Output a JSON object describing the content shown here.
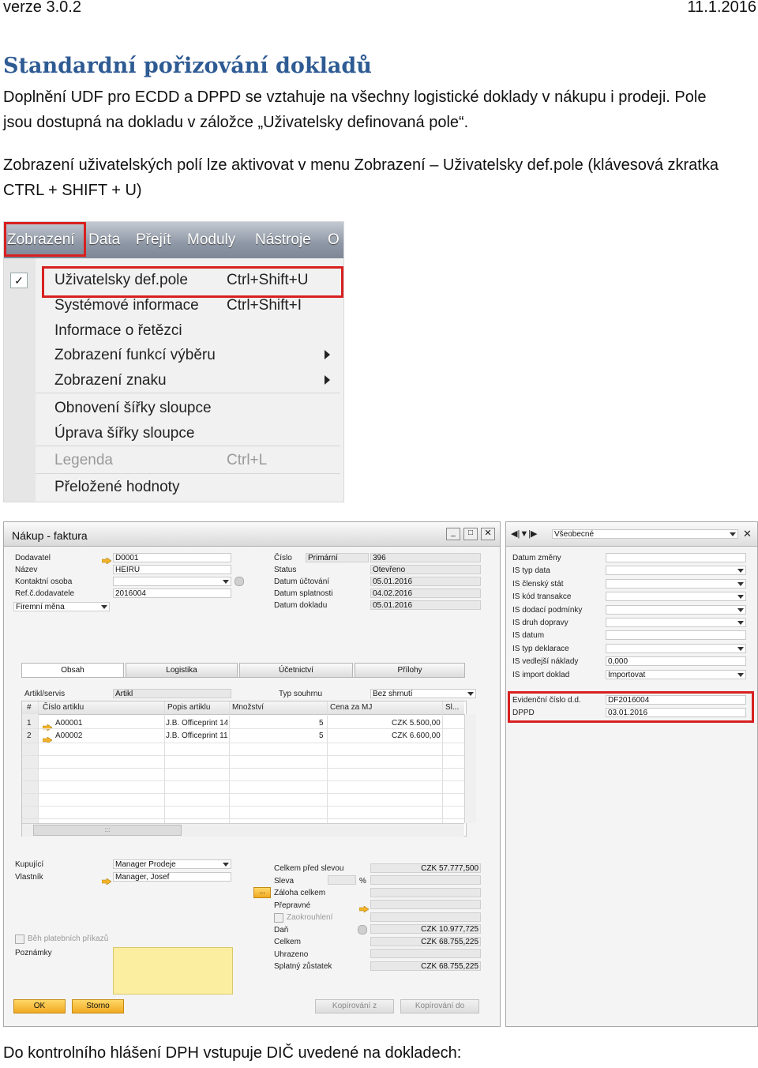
{
  "header": {
    "version": "verze 3.0.2",
    "date": "11.1.2016"
  },
  "heading": "Standardní pořizování dokladů",
  "paragraph1_line1": "Doplnění UDF pro ECDD a DPPD se vztahuje na všechny logistické doklady v nákupu i prodeji. Pole",
  "paragraph1_line2": "jsou dostupná na dokladu v záložce „Uživatelsky definovaná pole“.",
  "paragraph2_line1": "Zobrazení uživatelských polí lze aktivovat v menu Zobrazení – Uživatelsky def.pole (klávesová zkratka",
  "paragraph2_line2": "CTRL + SHIFT + U)",
  "menu": {
    "bar": [
      "Zobrazení",
      "Data",
      "Přejít",
      "Moduly",
      "Nástroje",
      "O"
    ],
    "items": [
      {
        "label": "Uživatelsky def.pole",
        "shortcut": "Ctrl+Shift+U"
      },
      {
        "label": "Systémové informace",
        "shortcut": "Ctrl+Shift+I"
      },
      {
        "label": "Informace o řetězci",
        "shortcut": ""
      },
      {
        "label": "Zobrazení funkcí výběru",
        "shortcut": ""
      },
      {
        "label": "Zobrazení znaku",
        "shortcut": ""
      },
      {
        "label": "Obnovení šířky sloupce",
        "shortcut": ""
      },
      {
        "label": "Úprava šířky sloupce",
        "shortcut": ""
      },
      {
        "label": "Legenda",
        "shortcut": "Ctrl+L"
      },
      {
        "label": "Přeložené hodnoty",
        "shortcut": ""
      }
    ]
  },
  "form": {
    "title": "Nákup - faktura",
    "left_labels": [
      "Dodavatel",
      "Název",
      "Kontaktní osoba",
      "Ref.č.dodavatele",
      "Firemní měna"
    ],
    "left_values": [
      "D0001",
      "HEIRU",
      "",
      "2016004"
    ],
    "right_labels": [
      "Číslo",
      "Status",
      "Datum účtování",
      "Datum splatnosti",
      "Datum dokladu"
    ],
    "cislo_type": "Primární",
    "right_values": [
      "396",
      "Otevřeno",
      "05.01.2016",
      "04.02.2016",
      "05.01.2016"
    ],
    "tabs": [
      "Obsah",
      "Logistika",
      "Účetnictví",
      "Přílohy"
    ],
    "item_type_label": "Artikl/servis",
    "item_type_value": "Artikl",
    "summary_type_label": "Typ souhrnu",
    "summary_type_value": "Bez shrnutí",
    "grid_headers": [
      "#",
      "Číslo artiklu",
      "Popis artiklu",
      "Množství",
      "Cena za MJ",
      "Sl..."
    ],
    "rows": [
      {
        "n": "1",
        "item": "A00001",
        "desc": "J.B. Officeprint 14",
        "qty": "5",
        "price": "CZK 5.500,00"
      },
      {
        "n": "2",
        "item": "A00002",
        "desc": "J.B. Officeprint 11",
        "qty": "5",
        "price": "CZK 6.600,00"
      }
    ],
    "grid_footer": ":::",
    "buyer_label": "Kupující",
    "buyer_value": "Manager Prodeje",
    "owner_label": "Vlastník",
    "owner_value": "Manager, Josef",
    "payment_orders": "Běh platebních příkazů",
    "notes_label": "Poznámky",
    "ellipsis": "...",
    "totals_labels": [
      "Celkem před slevou",
      "Sleva",
      "Záloha celkem",
      "Přepravné",
      "Zaokrouhlení",
      "Daň",
      "Celkem",
      "Uhrazeno",
      "Splatný zůstatek"
    ],
    "totals_values": [
      "CZK 57.777,500",
      "",
      "",
      "",
      "",
      "CZK 10.977,725",
      "CZK 68.755,225",
      "",
      "CZK 68.755,225"
    ],
    "percent": "%",
    "buttons": {
      "ok": "OK",
      "cancel": "Storno",
      "copy_from": "Kopírování z",
      "copy_to": "Kopírování do"
    }
  },
  "udf": {
    "dropdown": "Všeobecné",
    "labels": [
      "Datum změny",
      "IS typ data",
      "IS členský stát",
      "IS kód transakce",
      "IS dodací podmínky",
      "IS druh dopravy",
      "IS datum",
      "IS typ deklarace",
      "IS vedlejší náklady",
      "IS import doklad"
    ],
    "values": [
      "",
      "",
      "",
      "",
      "",
      "",
      "",
      "",
      "0,000",
      "Importovat"
    ],
    "ecdd_label": "Evidenční číslo d.d.",
    "ecdd_value": "DF2016004",
    "dppd_label": "DPPD",
    "dppd_value": "03.01.2016"
  },
  "bottom_text": "Do kontrolního hlášení DPH vstupuje DIČ uvedené na dokladech:"
}
